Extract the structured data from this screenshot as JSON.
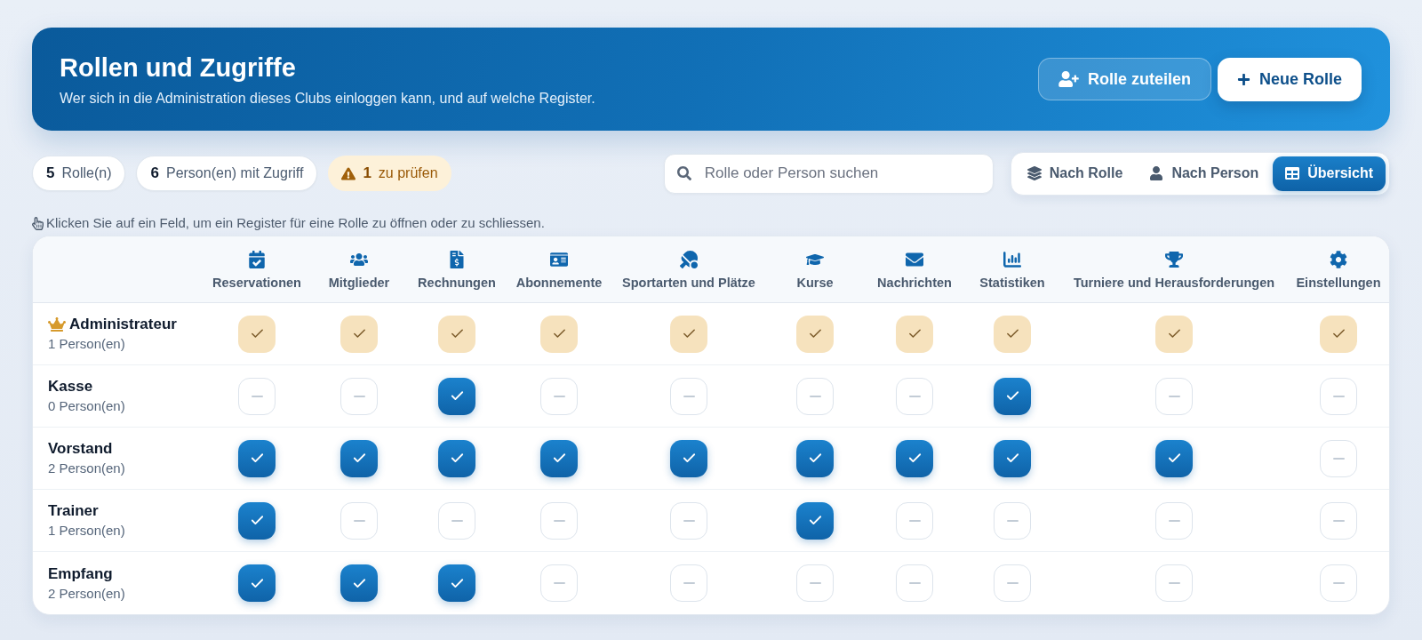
{
  "header": {
    "title": "Rollen und Zugriffe",
    "subtitle": "Wer sich in die Administration dieses Clubs einloggen kann, und auf welche Register.",
    "buttons": [
      {
        "label": "Rolle zuteilen",
        "kind": "secondary"
      },
      {
        "label": "Neue Rolle",
        "kind": "primary"
      }
    ]
  },
  "stats": [
    {
      "count": "5",
      "label": "Rolle(n)",
      "kind": "info"
    },
    {
      "count": "6",
      "label": "Person(en) mit Zugriff",
      "kind": "info"
    },
    {
      "count": "1",
      "label": "zu prüfen",
      "kind": "warning"
    }
  ],
  "search": {
    "placeholder": "Rolle oder Person suchen"
  },
  "view_tabs": [
    {
      "label": "Nach Rolle",
      "selected": false
    },
    {
      "label": "Nach Person",
      "selected": false
    },
    {
      "label": "Übersicht",
      "selected": true
    }
  ],
  "hint": "Klicken Sie auf ein Feld, um ein Register für eine Rolle zu öffnen oder zu schliessen.",
  "table": {
    "columns": [
      "Reservationen",
      "Mitglieder",
      "Rechnungen",
      "Abonnemente",
      "Sportarten und Plätze",
      "Kurse",
      "Nachrichten",
      "Statistiken",
      "Turniere und Herausforderungen",
      "Einstellungen"
    ],
    "roles": [
      {
        "name": "Administrateur",
        "persons": "1 Person(en)",
        "locked": true,
        "cells": [
          {
            "checked": true
          },
          {
            "checked": true
          },
          {
            "checked": true
          },
          {
            "checked": true
          },
          {
            "checked": true
          },
          {
            "checked": true
          },
          {
            "checked": true
          },
          {
            "checked": true
          },
          {
            "checked": true
          },
          {
            "checked": true
          }
        ]
      },
      {
        "name": "Kasse",
        "persons": "0 Person(en)",
        "locked": false,
        "cells": [
          {
            "checked": false
          },
          {
            "checked": false
          },
          {
            "checked": true
          },
          {
            "checked": false
          },
          {
            "checked": false
          },
          {
            "checked": false
          },
          {
            "checked": false
          },
          {
            "checked": true
          },
          {
            "checked": false
          },
          {
            "checked": false
          }
        ]
      },
      {
        "name": "Vorstand",
        "persons": "2 Person(en)",
        "locked": false,
        "cells": [
          {
            "checked": true
          },
          {
            "checked": true
          },
          {
            "checked": true
          },
          {
            "checked": true
          },
          {
            "checked": true
          },
          {
            "checked": true
          },
          {
            "checked": true
          },
          {
            "checked": true
          },
          {
            "checked": true
          },
          {
            "checked": false
          }
        ]
      },
      {
        "name": "Trainer",
        "persons": "1 Person(en)",
        "locked": false,
        "cells": [
          {
            "checked": true
          },
          {
            "checked": false
          },
          {
            "checked": false
          },
          {
            "checked": false
          },
          {
            "checked": false
          },
          {
            "checked": true
          },
          {
            "checked": false
          },
          {
            "checked": false
          },
          {
            "checked": false
          },
          {
            "checked": false
          }
        ]
      },
      {
        "name": "Empfang",
        "persons": "2 Person(en)",
        "locked": false,
        "cells": [
          {
            "checked": true
          },
          {
            "checked": true
          },
          {
            "checked": true
          },
          {
            "checked": false
          },
          {
            "checked": false
          },
          {
            "checked": false
          },
          {
            "checked": false
          },
          {
            "checked": false
          },
          {
            "checked": false
          },
          {
            "checked": false
          }
        ]
      }
    ]
  }
}
